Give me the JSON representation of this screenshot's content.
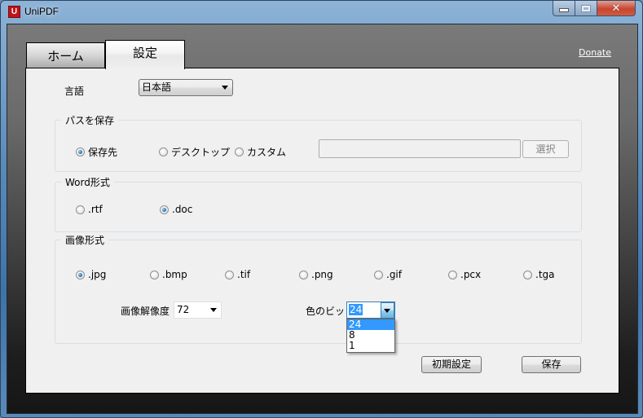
{
  "window": {
    "title": "UniPDF",
    "app_icon_letter": "U",
    "controls": {
      "minimize": "minimize",
      "maximize": "maximize",
      "close": "✕"
    }
  },
  "tabs": [
    {
      "label": "ホーム",
      "active": false
    },
    {
      "label": "設定",
      "active": true
    }
  ],
  "donate_link": "Donate",
  "settings": {
    "language": {
      "label": "言語",
      "value": "日本語"
    },
    "save_path": {
      "title": "パスを保存",
      "options": [
        {
          "label": "保存先",
          "checked": true
        },
        {
          "label": "デスクトップ",
          "checked": false
        },
        {
          "label": "カスタム",
          "checked": false
        }
      ],
      "path_value": "",
      "select_button": "選択"
    },
    "word_format": {
      "title": "Word形式",
      "options": [
        {
          "label": ".rtf",
          "checked": false
        },
        {
          "label": ".doc",
          "checked": true
        }
      ]
    },
    "image_format": {
      "title": "画像形式",
      "options": [
        {
          "label": ".jpg",
          "checked": true
        },
        {
          "label": ".bmp",
          "checked": false
        },
        {
          "label": ".tif",
          "checked": false
        },
        {
          "label": ".png",
          "checked": false
        },
        {
          "label": ".gif",
          "checked": false
        },
        {
          "label": ".pcx",
          "checked": false
        },
        {
          "label": ".tga",
          "checked": false
        }
      ],
      "resolution": {
        "label": "画像解像度",
        "value": "72"
      },
      "color_bits": {
        "label": "色のビット",
        "value": "24",
        "options": [
          "24",
          "8",
          "1"
        ],
        "highlighted": "24"
      }
    },
    "reset_button": "初期設定",
    "save_button": "保存"
  },
  "colors": {
    "selection": "#3399ff",
    "radio_on": "#1f63a8",
    "close_button": "#c8452f",
    "app_icon": "#c0141a"
  }
}
